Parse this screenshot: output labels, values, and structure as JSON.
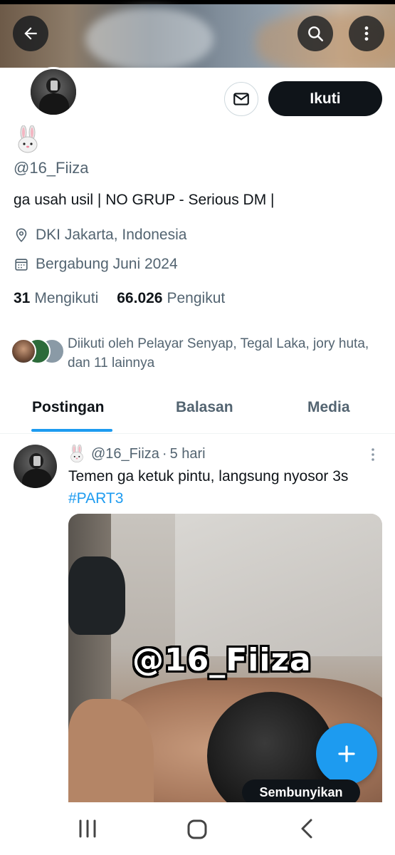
{
  "header": {
    "back_icon": "arrow-left-icon",
    "search_icon": "search-icon",
    "more_icon": "more-vertical-icon"
  },
  "profile": {
    "display_name_emoji": "rabbit-face-emoji",
    "handle": "@16_Fiiza",
    "bio": "ga usah usil | NO GRUP - Serious DM |",
    "location": "DKI Jakarta, Indonesia",
    "joined": "Bergabung Juni 2024",
    "following_count": "31",
    "following_label": "Mengikuti",
    "followers_count": "66.026",
    "followers_label": "Pengikut",
    "followed_by": "Diikuti oleh Pelayar Senyap, Tegal Laka, jory huta, dan 11 lainnya",
    "follow_label": "Ikuti",
    "mail_icon": "mail-icon"
  },
  "tabs": [
    {
      "label": "Postingan",
      "active": true
    },
    {
      "label": "Balasan",
      "active": false
    },
    {
      "label": "Media",
      "active": false
    }
  ],
  "post": {
    "handle": "@16_Fiiza",
    "separator": "·",
    "time": "5 hari",
    "text": "Temen ga ketuk pintu, langsung nyosor 3s ",
    "hashtag": "#PART3",
    "media_watermark": "@16_Fiiza"
  },
  "fab": {
    "icon": "plus-icon"
  },
  "hide_pill": "Sembunyikan",
  "colors": {
    "accent": "#1d9bf0",
    "text_primary": "#0f1419",
    "text_secondary": "#536471"
  }
}
